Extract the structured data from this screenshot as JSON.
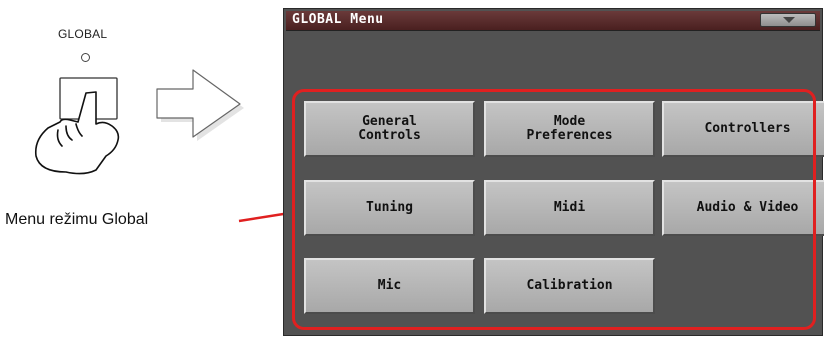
{
  "button_label": "GLOBAL",
  "caption": "Menu režimu Global",
  "screen": {
    "title": "GLOBAL Menu",
    "buttons": [
      {
        "label": "General\nControls"
      },
      {
        "label": "Mode\nPreferences"
      },
      {
        "label": "Controllers"
      },
      {
        "label": "Tuning"
      },
      {
        "label": "Midi"
      },
      {
        "label": "Audio & Video"
      },
      {
        "label": "Mic"
      },
      {
        "label": "Calibration"
      }
    ]
  },
  "colors": {
    "highlight": "#e02020",
    "screen_bg": "#525252",
    "title_bar": "#5a2a2a",
    "button_face": "#b6b6b6"
  },
  "icons": [
    "hand-press-icon",
    "arrow-right-icon",
    "menu-dropdown-icon"
  ]
}
